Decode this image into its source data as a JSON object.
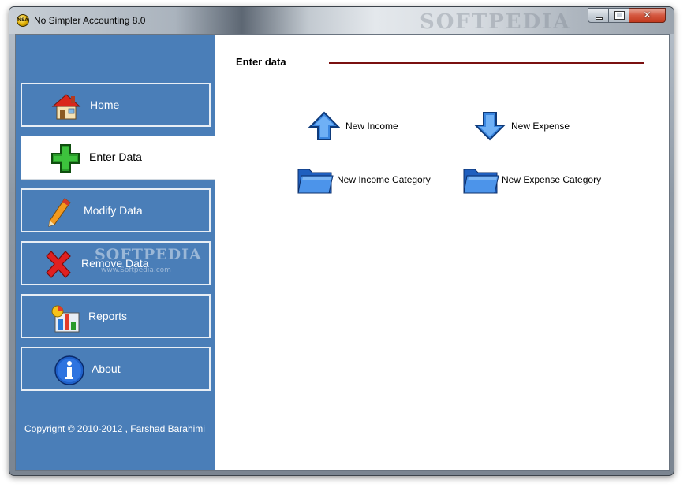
{
  "window": {
    "title": "No Simpler Accounting 8.0",
    "app_icon_text": "NSA",
    "titlebar_watermark": "SOFTPEDIA",
    "controls": {
      "minimize": "minimize",
      "maximize": "maximize",
      "close": "✕"
    }
  },
  "sidebar": {
    "items": [
      {
        "label": "Home",
        "icon": "house-icon",
        "active": false
      },
      {
        "label": "Enter Data",
        "icon": "green-plus-icon",
        "active": true
      },
      {
        "label": "Modify Data",
        "icon": "pen-icon",
        "active": false
      },
      {
        "label": "Remove Data",
        "icon": "red-x-icon",
        "active": false
      },
      {
        "label": "Reports",
        "icon": "chart-icon",
        "active": false
      },
      {
        "label": "About",
        "icon": "info-icon",
        "active": false
      }
    ],
    "copyright": "Copyright © 2010-2012 , Farshad Barahimi",
    "watermark": "SOFTPEDIA",
    "watermark_sub": "www.Softpedia.com"
  },
  "main": {
    "section_title": "Enter data",
    "actions": [
      {
        "label": "New Income",
        "icon": "up-arrow-icon"
      },
      {
        "label": "New Expense",
        "icon": "down-arrow-icon"
      },
      {
        "label": "New Income Category",
        "icon": "folder-icon"
      },
      {
        "label": "New Expense Category",
        "icon": "folder-icon"
      }
    ]
  },
  "colors": {
    "sidebar": "#4a7eb8",
    "section_rule": "#7a1010",
    "close_button": "#c23a1f"
  }
}
